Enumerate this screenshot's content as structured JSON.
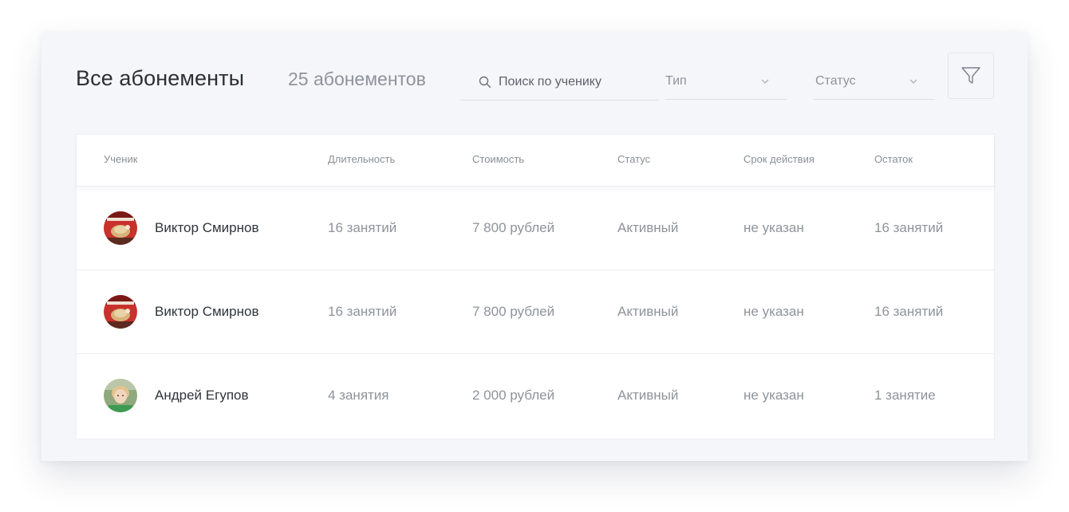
{
  "header": {
    "title": "Все абонементы",
    "count": "25 абонементов",
    "search_placeholder": "Поиск по ученику",
    "type_select": "Тип",
    "status_select": "Статус"
  },
  "icons": {
    "search": "search-icon",
    "chevron": "chevron-down-icon",
    "filter": "filter-icon"
  },
  "columns": [
    "Ученик",
    "Длительность",
    "Стоимость",
    "Статус",
    "Срок действия",
    "Остаток"
  ],
  "rows": [
    {
      "student": "Виктор Смирнов",
      "duration": "16 занятий",
      "price": "7 800 рублей",
      "status": "Активный",
      "expiry": "не указан",
      "remaining": "16 занятий"
    },
    {
      "student": "Виктор Смирнов",
      "duration": "16 занятий",
      "price": "7 800 рублей",
      "status": "Активный",
      "expiry": "не указан",
      "remaining": "16 занятий"
    },
    {
      "student": "Андрей Егупов",
      "duration": "4 занятия",
      "price": "2 000 рублей",
      "status": "Активный",
      "expiry": "не указан",
      "remaining": "1 занятие"
    }
  ]
}
